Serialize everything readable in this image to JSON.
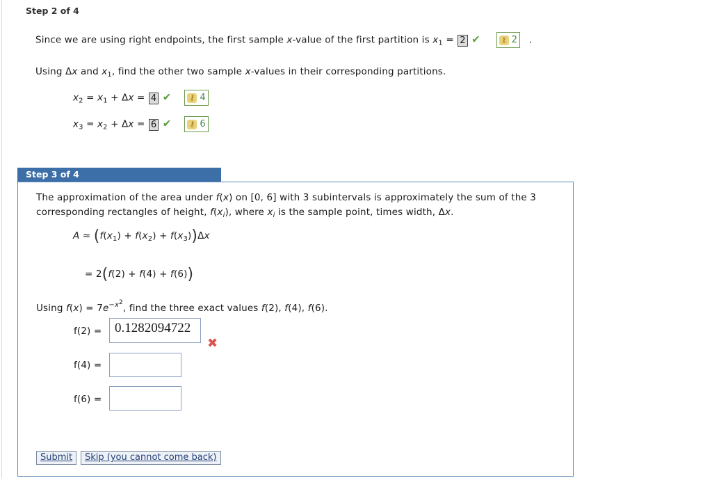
{
  "step2": {
    "header": "Step 2 of 4",
    "sentence_pre": "Since we are using right endpoints, the first sample ",
    "sentence_var": "x",
    "sentence_mid": "-value of the first partition is ",
    "x1_label": "x",
    "x1_sub": "1",
    "x1_value": "2",
    "x1_key": "2",
    "period": ".",
    "using_pre": "Using Δ",
    "using_x": "x",
    "using_and": " and ",
    "using_x1": "x",
    "using_x1_sub": "1",
    "using_post1": ", find the other two sample ",
    "using_x2": "x",
    "using_post2": "-values in their corresponding partitions.",
    "eq2": {
      "lhs": "x",
      "lhs_sub": "2",
      "rhs_var": "x",
      "rhs_sub": "1",
      "rhs_tail": " + Δ",
      "rhs_x": "x",
      "eq": " = ",
      "value": "4",
      "key": "4"
    },
    "eq3": {
      "lhs": "x",
      "lhs_sub": "3",
      "rhs_var": "x",
      "rhs_sub": "2",
      "rhs_tail": " + Δ",
      "rhs_x": "x",
      "eq": " = ",
      "value": "6",
      "key": "6"
    }
  },
  "step3": {
    "header": "Step 3 of 4",
    "para1_a": "The approximation of the area under ",
    "para1_fx": "f",
    "para1_b": "(",
    "para1_x": "x",
    "para1_c": ") on [0, 6] with 3 subintervals is approximately the sum of the 3",
    "para2_a": "corresponding rectangles of height, ",
    "para2_f": "f",
    "para2_b": "(",
    "para2_x": "x",
    "para2_i": "i",
    "para2_c": "), where ",
    "para2_x2": "x",
    "para2_i2": "i",
    "para2_d": " is the sample point, times width, Δ",
    "para2_x3": "x",
    "para2_e": ".",
    "approx_lhs": "A",
    "approx_sym": "≈",
    "sum_expr": "f(x1) + f(x2) + f(x3)",
    "dx": "Δx",
    "eq_line": "= 2",
    "eq_inner": "f(2) + f(4) + f(6)",
    "using_a": "Using ",
    "using_f": "f",
    "using_b": "(",
    "using_x": "x",
    "using_c": ") = 7",
    "using_e": "e",
    "using_exp": "−x",
    "using_exp2": "2",
    "using_d": ", find the three exact values ",
    "using_list": "f(2), f(4), f(6).",
    "f2_label": "f(2) =",
    "f2_value": "0.1282094722",
    "f4_label": "f(4) =",
    "f4_value": "",
    "f6_label": "f(6) =",
    "f6_value": "",
    "submit_label": "Submit",
    "skip_label": "Skip (you cannot come back)"
  },
  "colors": {
    "accent": "#3c6ea8",
    "check": "#5a9e3a",
    "error": "#d9534f"
  }
}
